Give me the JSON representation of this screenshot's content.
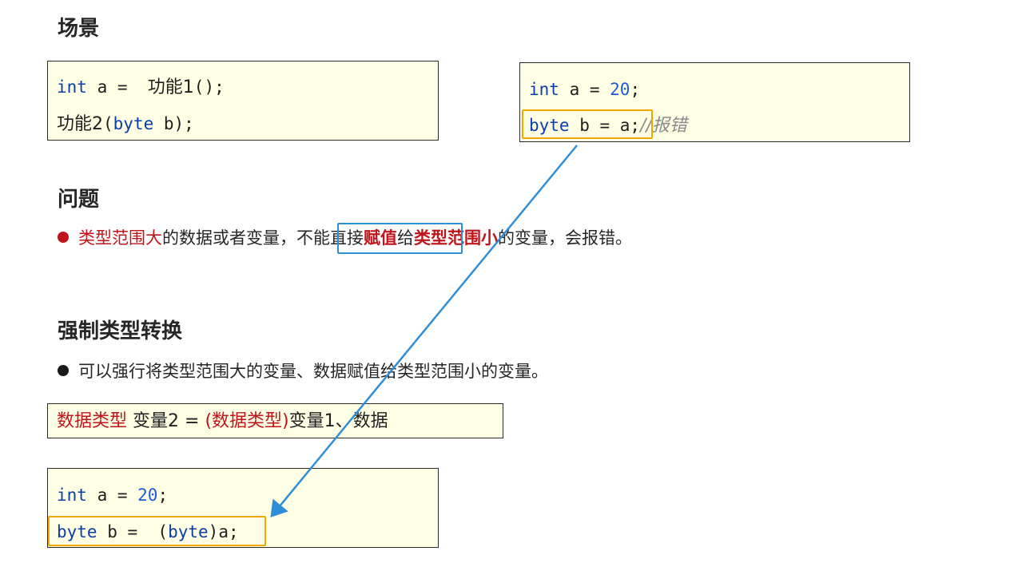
{
  "sections": {
    "scene": {
      "title": "场景",
      "box1": {
        "line1": {
          "kw": "int",
          "rest": " a =  ",
          "cjk": "功能1",
          "tail": "();"
        },
        "line2": {
          "cjk": "功能2",
          "paren": "(",
          "kw": "byte",
          "tail": " b);"
        }
      },
      "box2": {
        "line1": {
          "kw": "int",
          "mid": " a = ",
          "num": "20",
          "tail": ";"
        },
        "line2": {
          "kw": "byte",
          "tail": " b = a;",
          "comment": "//报错"
        }
      }
    },
    "problem": {
      "title": "问题",
      "bullet": {
        "part1": "类型范围大",
        "part2": "的数据或者变量，",
        "boxed_a": "不能直接",
        "boxed_b": "赋值",
        "part3": "给",
        "part4": "类型范围小",
        "part5": "的变量，会报错。"
      }
    },
    "cast": {
      "title": "强制类型转换",
      "bullet": "可以强行将类型范围大的变量、数据赋值给类型范围小的变量。",
      "syntax": {
        "type": "数据类型",
        "mid": " 变量2 = ",
        "paren_type": "(数据类型)",
        "tail": "变量1、数据"
      },
      "example": {
        "line1": {
          "kw": "int",
          "mid": " a = ",
          "num": "20",
          "tail": ";"
        },
        "line2": {
          "kw": "byte",
          "mid": " b =  (",
          "kw2": "byte",
          "tail": ")a;"
        }
      }
    }
  },
  "colors": {
    "accent_blue": "#2f8ed8",
    "highlight_orange": "#f0a800",
    "code_bg": "#ffffe6",
    "keyword": "#0a3ea8",
    "emphasis_red": "#c0141b"
  }
}
